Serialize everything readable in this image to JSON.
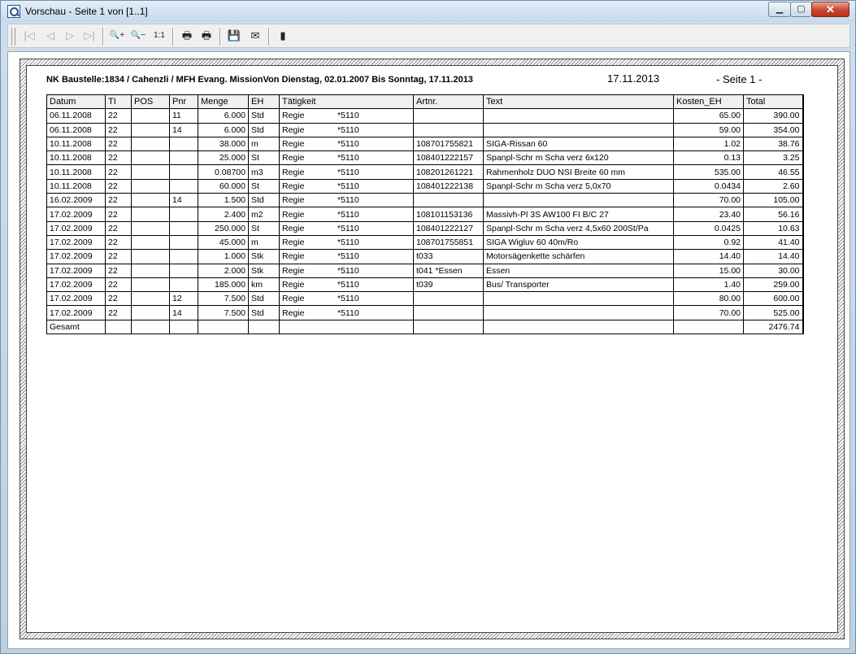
{
  "window": {
    "title": "Vorschau - Seite 1 von [1..1]",
    "minimize": "▁",
    "maximize": "▢",
    "close": "✕"
  },
  "toolbar": {
    "first": "|◁",
    "prev": "◁",
    "next": "▷",
    "last": "▷|",
    "zoom_in": "🔍+",
    "zoom_out": "🔍−",
    "actual_size": "1:1",
    "print": "🖶",
    "print_setup": "🖶",
    "save": "💾",
    "email": "✉",
    "exit": "▮"
  },
  "report": {
    "title": "NK Baustelle:1834 / Cahenzli / MFH Evang. MissionVon Dienstag, 02.01.2007 Bis Sonntag, 17.11.2013",
    "date": "17.11.2013",
    "page": "- Seite 1 -",
    "headers": [
      "Datum",
      "TI",
      "POS",
      "Pnr",
      "Menge",
      "EH",
      "Tätigkeit",
      "Artnr.",
      "Text",
      "Kosten_EH",
      "Total"
    ],
    "rows": [
      [
        "06.11.2008",
        "22",
        "",
        "11",
        "6.000",
        "Std",
        "Regie",
        "*5110",
        "",
        "",
        "65.00",
        "390.00"
      ],
      [
        "06.11.2008",
        "22",
        "",
        "14",
        "6.000",
        "Std",
        "Regie",
        "*5110",
        "",
        "",
        "59.00",
        "354.00"
      ],
      [
        "10.11.2008",
        "22",
        "",
        "",
        "38.000",
        "m",
        "Regie",
        "*5110",
        "108701755821",
        "SIGA-Rissan 60",
        "1.02",
        "38.76"
      ],
      [
        "10.11.2008",
        "22",
        "",
        "",
        "25.000",
        "St",
        "Regie",
        "*5110",
        "108401222157",
        "Spanpl-Schr m Scha verz 6x120",
        "0.13",
        "3.25"
      ],
      [
        "10.11.2008",
        "22",
        "",
        "",
        "0.08700",
        "m3",
        "Regie",
        "*5110",
        "108201261221",
        "Rahmenholz DUO NSI Breite 60 mm",
        "535.00",
        "46.55"
      ],
      [
        "10.11.2008",
        "22",
        "",
        "",
        "60.000",
        "St",
        "Regie",
        "*5110",
        "108401222138",
        "Spanpl-Schr m Scha verz 5,0x70",
        "0.0434",
        "2.60"
      ],
      [
        "16.02.2009",
        "22",
        "",
        "14",
        "1.500",
        "Std",
        "Regie",
        "*5110",
        "",
        "",
        "70.00",
        "105.00"
      ],
      [
        "17.02.2009",
        "22",
        "",
        "",
        "2.400",
        "m2",
        "Regie",
        "*5110",
        "108101153136",
        "Massivh-Pl 3S AW100 FI B/C 27",
        "23.40",
        "56.16"
      ],
      [
        "17.02.2009",
        "22",
        "",
        "",
        "250.000",
        "St",
        "Regie",
        "*5110",
        "108401222127",
        "Spanpl-Schr m Scha verz 4,5x60 200St/Pa",
        "0.0425",
        "10.63"
      ],
      [
        "17.02.2009",
        "22",
        "",
        "",
        "45.000",
        "m",
        "Regie",
        "*5110",
        "108701755851",
        "SIGA Wigluv 60 40m/Ro",
        "0.92",
        "41.40"
      ],
      [
        "17.02.2009",
        "22",
        "",
        "",
        "1.000",
        "Stk",
        "Regie",
        "*5110",
        "t033",
        "Motorsägenkette schärfen",
        "14.40",
        "14.40"
      ],
      [
        "17.02.2009",
        "22",
        "",
        "",
        "2.000",
        "Stk",
        "Regie",
        "*5110",
        "t041 *Essen",
        "Essen",
        "15.00",
        "30.00"
      ],
      [
        "17.02.2009",
        "22",
        "",
        "",
        "185.000",
        "km",
        "Regie",
        "*5110",
        "t039",
        "Bus/ Transporter",
        "1.40",
        "259.00"
      ],
      [
        "17.02.2009",
        "22",
        "",
        "12",
        "7.500",
        "Std",
        "Regie",
        "*5110",
        "",
        "",
        "80.00",
        "600.00"
      ],
      [
        "17.02.2009",
        "22",
        "",
        "14",
        "7.500",
        "Std",
        "Regie",
        "*5110",
        "",
        "",
        "70.00",
        "525.00"
      ]
    ],
    "sum_label": "Gesamt",
    "sum_total": "2476.74"
  }
}
